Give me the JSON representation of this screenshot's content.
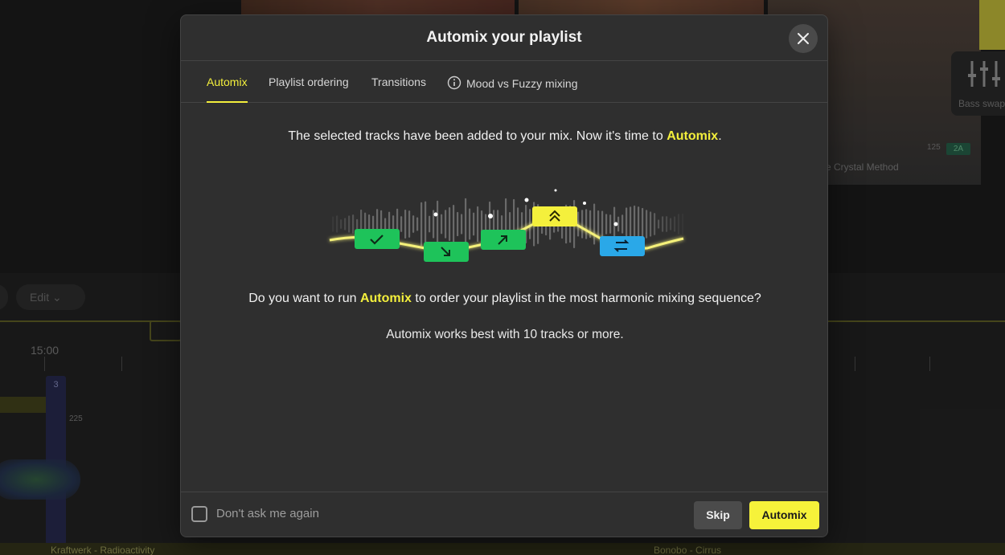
{
  "background": {
    "edit_label": "Edit ⌄",
    "time_label": "15:00",
    "track_left": "Kraftwerk - Radioactivity",
    "track_right": "Bonobo - Cirrus",
    "artist_label": "e Crystal Method",
    "bass_label": "Bass swap",
    "bpm_label": "125",
    "key_label": "2A",
    "marker_number": "3",
    "marker_bpm": "225"
  },
  "modal": {
    "title": "Automix your playlist",
    "tabs": [
      {
        "label": "Automix"
      },
      {
        "label": "Playlist ordering"
      },
      {
        "label": "Transitions"
      },
      {
        "label": "Mood vs Fuzzy mixing"
      }
    ],
    "lead_prefix": "The selected tracks have been added to your mix. Now it's time to ",
    "lead_highlight": "Automix",
    "lead_suffix": ".",
    "question_prefix": "Do you want to run ",
    "question_highlight": "Automix",
    "question_suffix": " to order your playlist in the most harmonic mixing sequence?",
    "note": "Automix works best with 10 tracks or more.",
    "footer": {
      "checkbox_label": "Don't ask me again",
      "skip_label": "Skip",
      "automix_label": "Automix"
    }
  },
  "colors": {
    "accent": "#f3ef3c",
    "green": "#1ec35a",
    "blue": "#2aa8e8"
  }
}
